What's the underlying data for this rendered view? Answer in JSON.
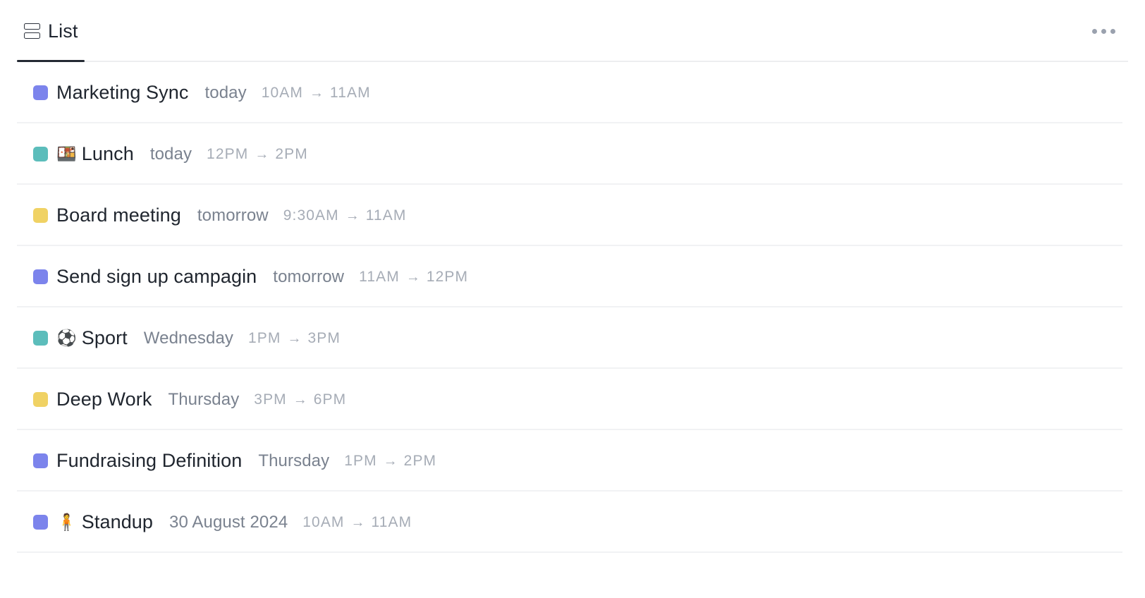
{
  "header": {
    "tabs": [
      {
        "label": "List",
        "icon": "list-rows-icon",
        "active": true
      }
    ],
    "more_menu": {
      "icon": "ellipsis-horizontal-icon",
      "label": "More options"
    }
  },
  "colors": {
    "purple": "#7c84ec",
    "teal": "#5cbdbb",
    "yellow": "#f0d264",
    "active_tab_underline": "#242a33",
    "divider": "#f1f2f4",
    "title_text": "#20262f",
    "date_text": "#7a828f",
    "time_text": "#a6acb6"
  },
  "list": {
    "arrow": "→",
    "events": [
      {
        "color": "#7c84ec",
        "color_name": "purple",
        "emoji": "",
        "title": "Marketing Sync",
        "date": "today",
        "start": "10AM",
        "end": "11AM"
      },
      {
        "color": "#5cbdbb",
        "color_name": "teal",
        "emoji": "🍱",
        "title": "Lunch",
        "date": "today",
        "start": "12PM",
        "end": "2PM"
      },
      {
        "color": "#f0d264",
        "color_name": "yellow",
        "emoji": "",
        "title": "Board meeting",
        "date": "tomorrow",
        "start": "9:30AM",
        "end": "11AM"
      },
      {
        "color": "#7c84ec",
        "color_name": "purple",
        "emoji": "",
        "title": "Send sign up campagin",
        "date": "tomorrow",
        "start": "11AM",
        "end": "12PM"
      },
      {
        "color": "#5cbdbb",
        "color_name": "teal",
        "emoji": "⚽",
        "title": "Sport",
        "date": "Wednesday",
        "start": "1PM",
        "end": "3PM"
      },
      {
        "color": "#f0d264",
        "color_name": "yellow",
        "emoji": "",
        "title": "Deep Work",
        "date": "Thursday",
        "start": "3PM",
        "end": "6PM"
      },
      {
        "color": "#7c84ec",
        "color_name": "purple",
        "emoji": "",
        "title": "Fundraising Definition",
        "date": "Thursday",
        "start": "1PM",
        "end": "2PM"
      },
      {
        "color": "#7c84ec",
        "color_name": "purple",
        "emoji": "🧍",
        "title": "Standup",
        "date": "30 August 2024",
        "start": "10AM",
        "end": "11AM"
      }
    ]
  }
}
